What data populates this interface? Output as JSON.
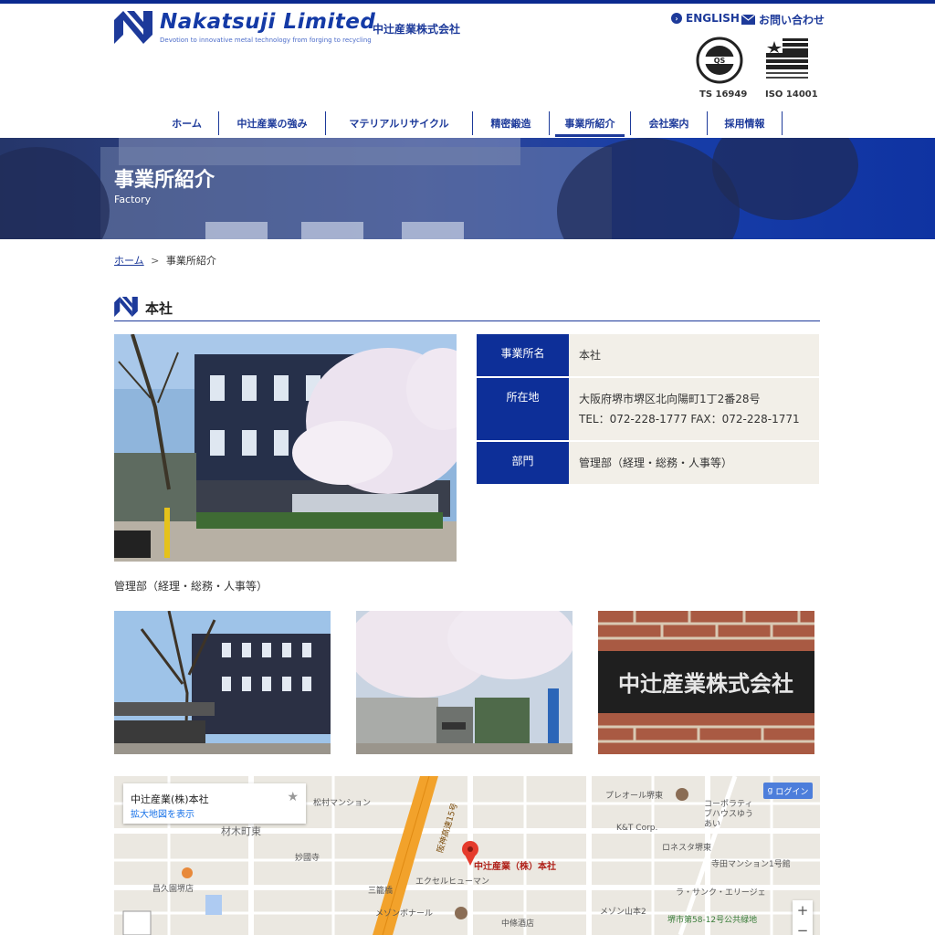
{
  "header": {
    "logo_name": "Nakatsuji Limited",
    "logo_tagline": "Devotion to innovative metal technology from forging to recycling",
    "company_name_jp": "中辻産業株式会社",
    "english_link": "ENGLISH",
    "contact_link": "お問い合わせ",
    "certifications": [
      "TS 16949",
      "ISO 14001"
    ]
  },
  "nav": {
    "items": [
      {
        "label": "ホーム",
        "active": false
      },
      {
        "label": "中辻産業の強み",
        "active": false
      },
      {
        "label": "マテリアルリサイクル",
        "active": false
      },
      {
        "label": "精密鍛造",
        "active": false
      },
      {
        "label": "事業所紹介",
        "active": true
      },
      {
        "label": "会社案内",
        "active": false
      },
      {
        "label": "採用情報",
        "active": false
      }
    ]
  },
  "banner": {
    "title": "事業所紹介",
    "subtitle": "Factory"
  },
  "breadcrumb": {
    "home": "ホーム",
    "separator": ">",
    "current": "事業所紹介"
  },
  "section": {
    "title": "本社",
    "table": [
      {
        "label": "事業所名",
        "lines": [
          "本社"
        ]
      },
      {
        "label": "所在地",
        "lines": [
          "大阪府堺市堺区北向陽町1丁2番28号",
          "TEL：072-228-1777 FAX：072-228-1771"
        ]
      },
      {
        "label": "部門",
        "lines": [
          "管理部（経理・総務・人事等）"
        ]
      }
    ],
    "caption": "管理部（経理・総務・人事等）"
  },
  "map": {
    "place_title": "中辻産業(株)本社",
    "enlarge_link": "拡大地図を表示",
    "login_label": "ログイン",
    "zoom_in": "+",
    "zoom_out": "−",
    "labels": {
      "l1": "材木町東",
      "l2": "妙國寺",
      "l3": "昌久園堺店",
      "l4": "中辻産業（株）本社",
      "l5": "エクセルヒューマン",
      "l6": "プレオール堺東",
      "l7": "コーポラティブハウスゆうあい",
      "l8": "K&T Corp.",
      "l9": "ロネスタ堺東",
      "l10": "寺田マンション1号館",
      "l11": "ラ・サンク・エリージェ",
      "l12": "堺市第58-12号公共緑地",
      "l13": "メゾン山本2",
      "l14": "中條酒店",
      "l15": "メゾンボナール",
      "l16": "阪神高速15号",
      "l17": "松村マンション",
      "l18": "三籠橋"
    }
  },
  "colors": {
    "brand": "#1d3a9a",
    "table_header": "#0d2f98",
    "table_cell": "#f2efe8"
  }
}
